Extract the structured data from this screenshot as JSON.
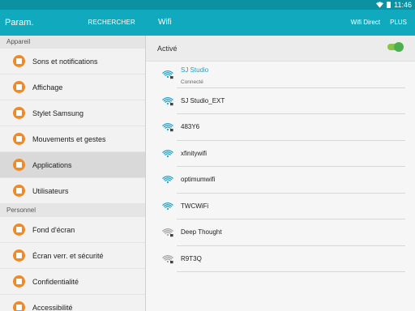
{
  "status_bar": {
    "time": "11:46"
  },
  "left_header": {
    "title": "Param.",
    "search_label": "RECHERCHER"
  },
  "right_header": {
    "title": "Wifi",
    "wifi_direct_label": "Wifi Direct",
    "more_label": "PLUS"
  },
  "sidebar": {
    "sections": [
      {
        "title": "Appareil",
        "items": [
          {
            "label": "Sons et notifications",
            "icon": "volume-icon",
            "color": "#f08a24"
          },
          {
            "label": "Affichage",
            "icon": "display-icon",
            "color": "#f08a24"
          },
          {
            "label": "Stylet Samsung",
            "icon": "pen-icon",
            "color": "#f08a24"
          },
          {
            "label": "Mouvements et gestes",
            "icon": "gesture-icon",
            "color": "#f08a24"
          },
          {
            "label": "Applications",
            "icon": "apps-icon",
            "color": "#f08a24",
            "selected": true
          },
          {
            "label": "Utilisateurs",
            "icon": "users-icon",
            "color": "#f08a24"
          }
        ]
      },
      {
        "title": "Personnel",
        "items": [
          {
            "label": "Fond d'écran",
            "icon": "wallpaper-icon",
            "color": "#f08a24"
          },
          {
            "label": "Écran verr. et sécurité",
            "icon": "lock-icon",
            "color": "#f08a24"
          },
          {
            "label": "Confidentialité",
            "icon": "privacy-icon",
            "color": "#f08a24"
          },
          {
            "label": "Accessibilité",
            "icon": "accessibility-icon",
            "color": "#f08a24"
          }
        ]
      }
    ]
  },
  "wifi": {
    "toggle_label": "Activé",
    "toggle_on": true,
    "accent": "#1b9fc5",
    "networks": [
      {
        "name": "SJ Studio",
        "status": "Connecté",
        "secured": true,
        "connected": true
      },
      {
        "name": "SJ Studio_EXT",
        "secured": true
      },
      {
        "name": "483Y6",
        "secured": true
      },
      {
        "name": "xfinitywifi",
        "secured": false
      },
      {
        "name": "optimumwifi",
        "secured": false
      },
      {
        "name": "TWCWiFi",
        "secured": false
      },
      {
        "name": "Deep Thought",
        "secured": true,
        "weak": true
      },
      {
        "name": "R9T3Q",
        "secured": true,
        "weak": true
      }
    ]
  }
}
